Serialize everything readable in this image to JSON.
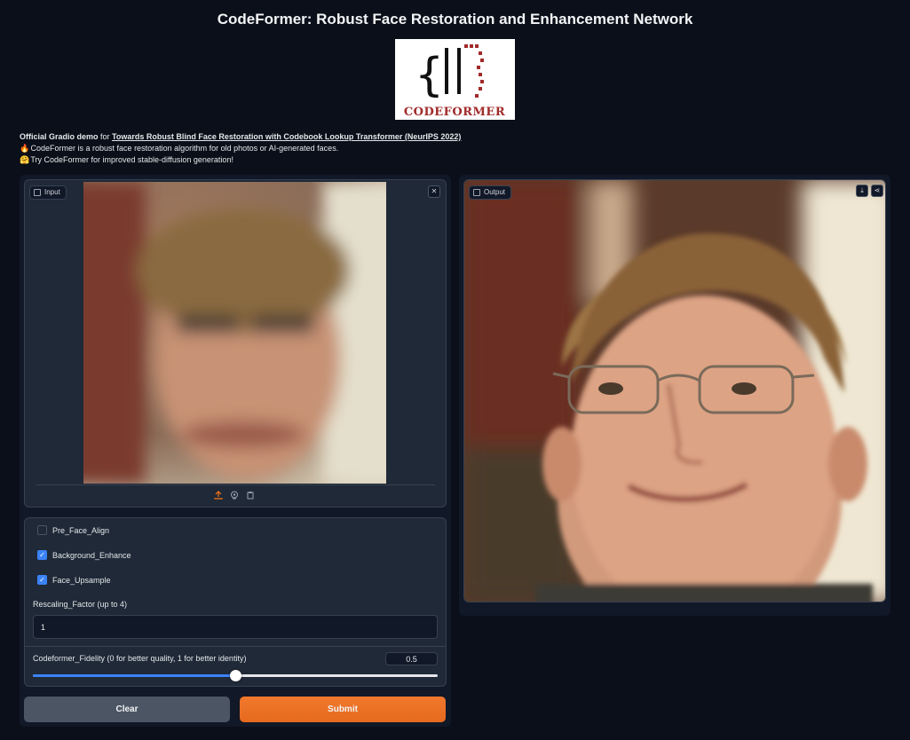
{
  "header": {
    "title": "CodeFormer: Robust Face Restoration and Enhancement Network"
  },
  "logo": {
    "wordmark": "CODEFORMER"
  },
  "description": {
    "line1_prefix": "Official Gradio demo",
    "line1_for": " for ",
    "line1_link": "Towards Robust Blind Face Restoration with Codebook Lookup Transformer (NeurIPS 2022)",
    "line2": "CodeFormer is a robust face restoration algorithm for old photos or AI-generated faces.",
    "line3": "Try CodeFormer for improved stable-diffusion generation!"
  },
  "input": {
    "label": "Input",
    "clear_icon": "close-icon",
    "sources": [
      "upload-icon",
      "webcam-icon",
      "clipboard-icon"
    ]
  },
  "output": {
    "label": "Output",
    "actions": [
      "download-icon",
      "share-icon"
    ]
  },
  "options": {
    "pre_face_align": {
      "label": "Pre_Face_Align",
      "checked": false
    },
    "background_enhance": {
      "label": "Background_Enhance",
      "checked": true
    },
    "face_upsample": {
      "label": "Face_Upsample",
      "checked": true
    },
    "rescaling": {
      "label": "Rescaling_Factor (up to 4)",
      "value": "1"
    },
    "fidelity": {
      "label": "Codeformer_Fidelity (0 for better quality, 1 for better identity)",
      "value": "0.5",
      "fraction": 0.5
    }
  },
  "buttons": {
    "clear": "Clear",
    "submit": "Submit"
  },
  "colors": {
    "accent": "#3b82f6",
    "primary": "#e86e21",
    "background": "#0b0f19"
  }
}
